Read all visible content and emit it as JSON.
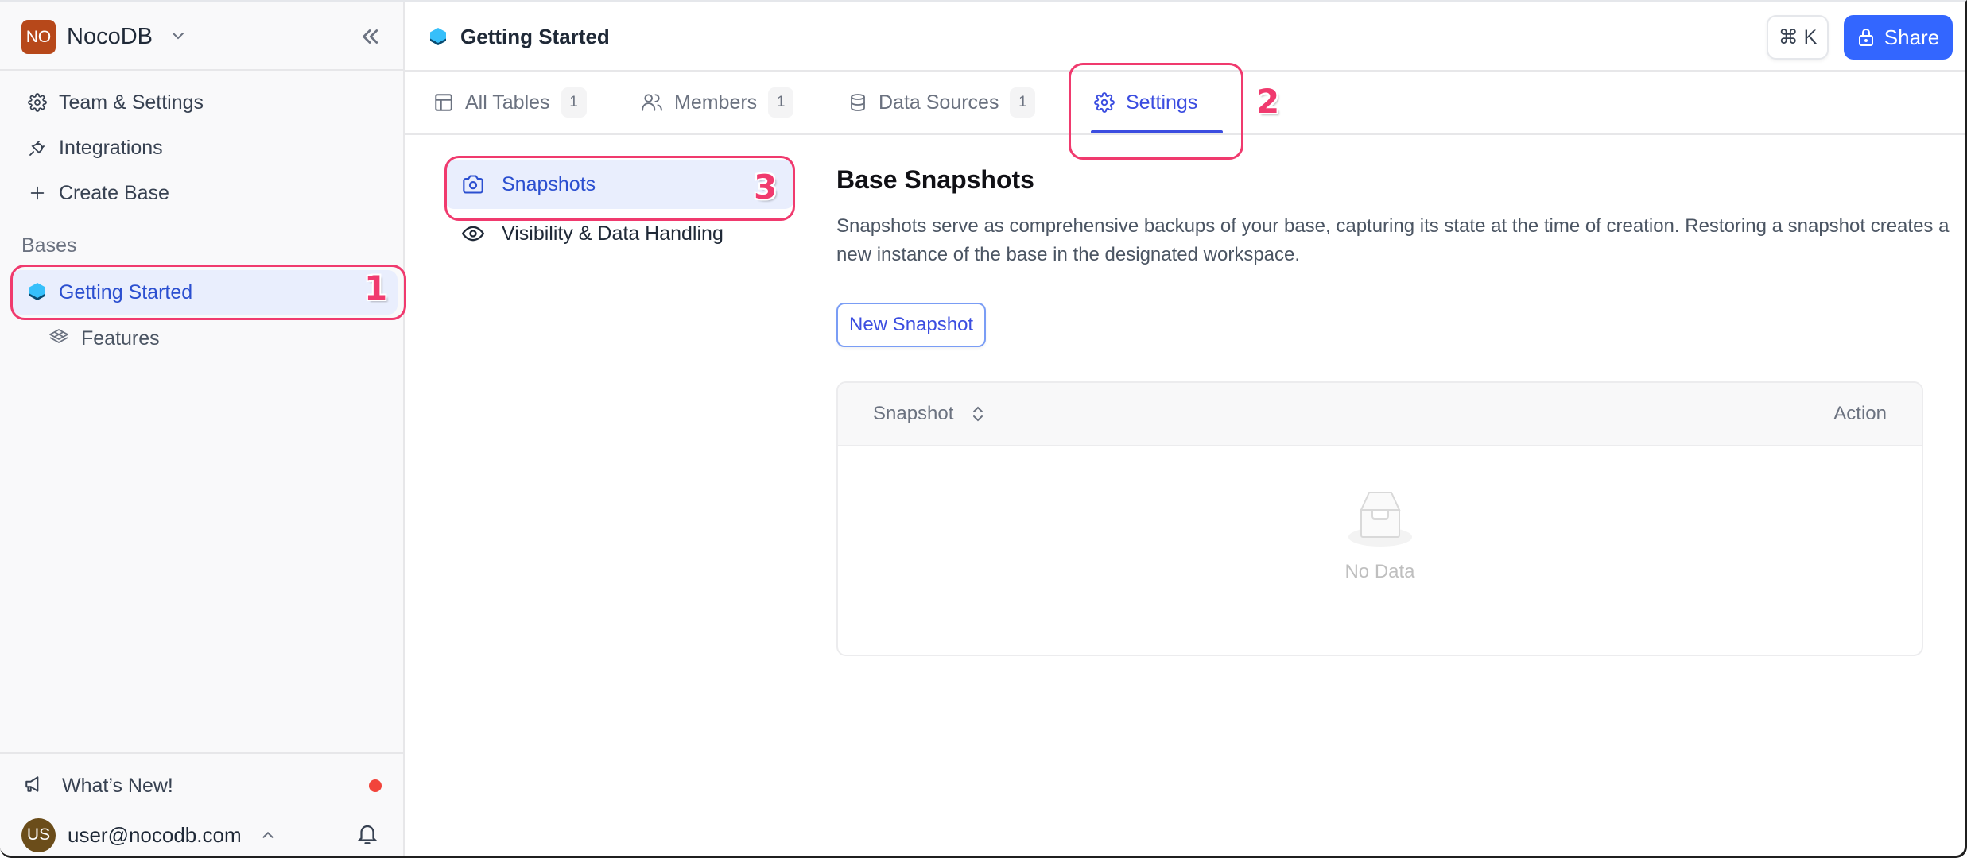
{
  "workspace": {
    "initials": "NO",
    "name": "NocoDB",
    "avatar_color": "#b7481a"
  },
  "sidebar": {
    "items": [
      {
        "label": "Team & Settings",
        "icon": "gear-icon"
      },
      {
        "label": "Integrations",
        "icon": "plug-icon"
      },
      {
        "label": "Create Base",
        "icon": "plus-icon"
      }
    ],
    "section_label": "Bases",
    "bases": [
      {
        "label": "Getting Started",
        "icon": "base-icon",
        "active": true,
        "children": [
          {
            "label": "Features",
            "icon": "table-stack-icon"
          }
        ]
      }
    ],
    "footer": {
      "whats_new": "What’s New!",
      "user_initials": "US",
      "user_email": "user@nocodb.com"
    }
  },
  "header": {
    "breadcrumb": "Getting Started",
    "cmdk_label": "⌘ K",
    "share_label": "Share"
  },
  "tabs": [
    {
      "label": "All Tables",
      "count": "1",
      "icon": "table-icon"
    },
    {
      "label": "Members",
      "count": "1",
      "icon": "users-icon"
    },
    {
      "label": "Data Sources",
      "count": "1",
      "icon": "database-icon"
    },
    {
      "label": "Settings",
      "icon": "gear-icon",
      "active": true
    }
  ],
  "settings_nav": [
    {
      "label": "Snapshots",
      "icon": "camera-icon",
      "active": true
    },
    {
      "label": "Visibility & Data Handling",
      "icon": "eye-icon"
    }
  ],
  "content": {
    "title": "Base Snapshots",
    "description": "Snapshots serve as comprehensive backups of your base, capturing its state at the time of creation. Restoring a snapshot creates a new instance of the base in the designated workspace.",
    "new_button": "New Snapshot",
    "table": {
      "columns": [
        "Snapshot",
        "Action"
      ],
      "rows": [],
      "empty_text": "No Data"
    }
  },
  "annotations": [
    "1",
    "2",
    "3"
  ],
  "colors": {
    "accent": "#3366ff",
    "active_text": "#2b4fd0",
    "annotation": "#f03a6e",
    "notification_dot": "#f2443b"
  }
}
